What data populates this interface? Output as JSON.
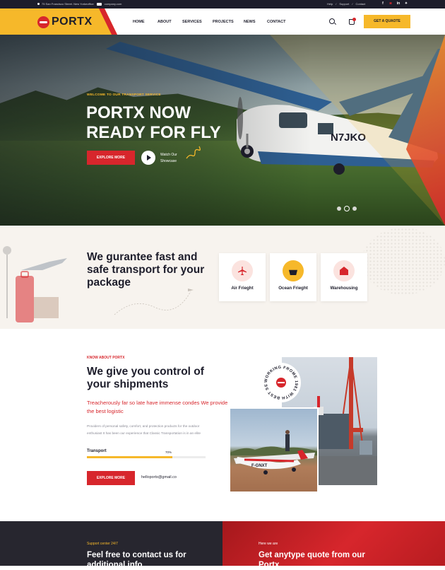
{
  "topbar": {
    "address": "75 San Francisco Street. New Yorkeoffice",
    "email_suffix": "company.com",
    "links": [
      "Help",
      "/",
      "Support",
      "/",
      "Contact"
    ],
    "social_icons": [
      "facebook-icon",
      "instagram-icon",
      "linkedin-icon",
      "twitter-icon"
    ]
  },
  "brand": {
    "name": "PORTX",
    "colors": {
      "yellow": "#f6b82a",
      "red": "#d7262c",
      "dark": "#1d1d2b"
    }
  },
  "nav": [
    "HOME",
    "ABOUT",
    "SERVICES",
    "PROJECTS",
    "NEWS",
    "CONTACT"
  ],
  "header": {
    "cta": "GET A QUAOTE"
  },
  "hero": {
    "subtitle": "WELCOME TO OUR TRANSPORT SERVICE",
    "title": "PORTX NOW READY FOR FLY",
    "button": "EXPLORE MORE",
    "watch": "Watch Our Showcase",
    "slides": 3,
    "active_slide": 2
  },
  "guarantee": {
    "title": "We gurantee fast and safe transport for your package",
    "cards": [
      {
        "label": "Air Frieght",
        "icon": "plane-icon"
      },
      {
        "label": "Ocean Frieght",
        "icon": "ship-icon"
      },
      {
        "label": "Warehousing",
        "icon": "warehouse-icon"
      }
    ]
  },
  "about": {
    "subtitle": "KNOW ABOUT PORTX",
    "title": "We give you control of your shipments",
    "highlight": "Treacherously far so late have immense condes We provide the best logistic",
    "text": "Providers of personal safety, comfort, and protection products for the outdoor enthusiast It has been our experience that Classic Transportation is in an elite",
    "progress": {
      "label": "Transport",
      "value": "70%",
      "fraction": 0.72
    },
    "button": "EXPLORE MORE",
    "email": "helloportx@gmail.co",
    "badge_text": "WORKING FROME 1981 WITH BEST SERVICE"
  },
  "bottom": {
    "left": {
      "sub": "Support center 24/7",
      "title": "Feel free to contact us for additional info"
    },
    "right": {
      "sub": "Here we are",
      "title": "Get anytype quote from our Portx"
    }
  }
}
